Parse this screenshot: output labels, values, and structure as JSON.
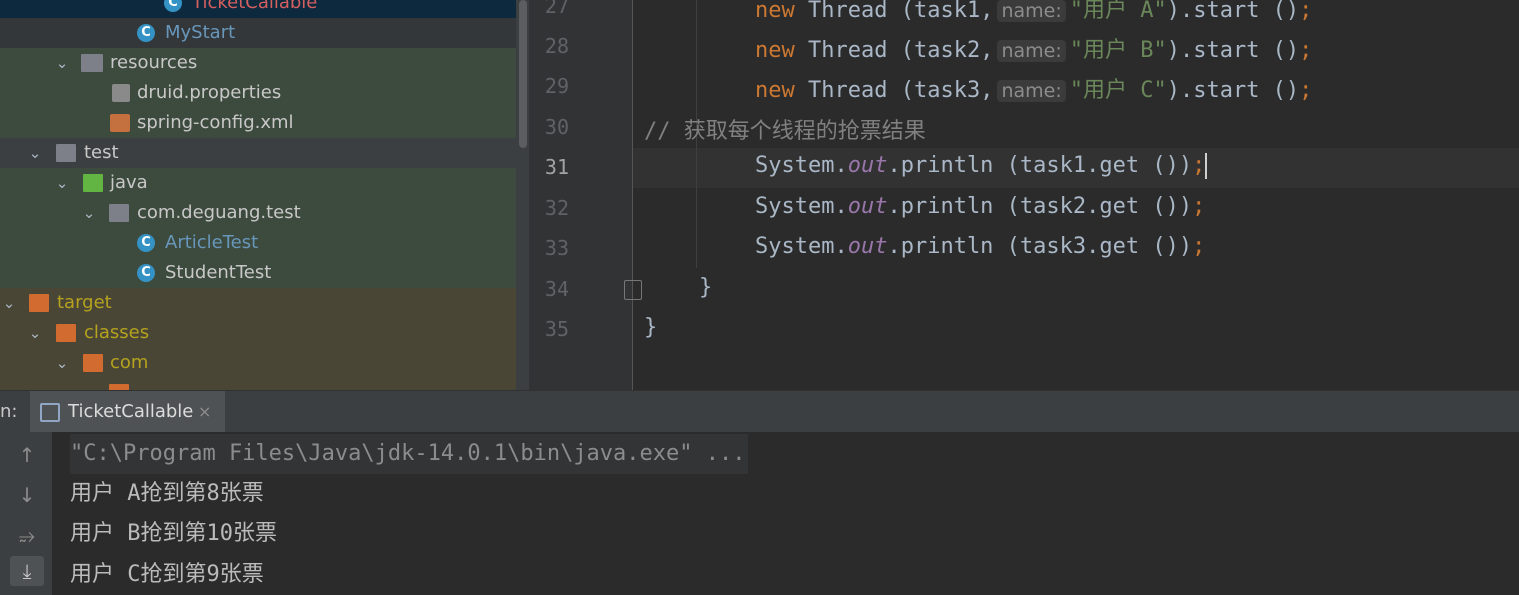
{
  "tree": {
    "items": [
      {
        "label": "TicketCallable",
        "icon": "class-icon",
        "level": 6
      },
      {
        "label": "MyStart",
        "icon": "class-icon",
        "level": 5
      },
      {
        "label": "resources",
        "icon": "resources-folder-icon",
        "level": 2
      },
      {
        "label": "druid.properties",
        "icon": "properties-file-icon",
        "level": 3
      },
      {
        "label": "spring-config.xml",
        "icon": "xml-file-icon",
        "level": 3
      },
      {
        "label": "test",
        "icon": "folder-icon",
        "level": 1
      },
      {
        "label": "java",
        "icon": "test-source-folder-icon",
        "level": 2
      },
      {
        "label": "com.deguang.test",
        "icon": "package-icon",
        "level": 3
      },
      {
        "label": "ArticleTest",
        "icon": "class-icon",
        "level": 4
      },
      {
        "label": "StudentTest",
        "icon": "class-icon",
        "level": 4
      },
      {
        "label": "target",
        "icon": "excluded-folder-icon",
        "level": 0
      },
      {
        "label": "classes",
        "icon": "excluded-folder-icon",
        "level": 1
      },
      {
        "label": "com",
        "icon": "excluded-folder-icon",
        "level": 2
      }
    ]
  },
  "editor": {
    "line_numbers": [
      "27",
      "28",
      "29",
      "30",
      "31",
      "32",
      "33",
      "34",
      "35"
    ],
    "current_line": "31",
    "code": {
      "kw_new": "new",
      "thread_open": " Thread (task",
      "t1": "1,",
      "t2": "2,",
      "t3": "3,",
      "hint": "name:",
      "s1": "\"用户 A\"",
      "s2": "\"用户 B\"",
      "s3": "\"用户 C\"",
      "start": ").start ()",
      "semi": ";",
      "comment": "// 获取每个线程的抢票结果",
      "sys": "System.",
      "out": "out",
      "p1": ".println (task1.get ())",
      "p2": ".println (task2.get ())",
      "p3": ".println (task3.get ())",
      "brace_inner": "}",
      "brace_outer": "}"
    }
  },
  "run": {
    "label": "n:",
    "tab_label": "TicketCallable",
    "tab_close": "×",
    "output": [
      "\"C:\\Program Files\\Java\\jdk-14.0.1\\bin\\java.exe\" ...",
      "用户 A抢到第8张票",
      "用户 B抢到第10张票",
      "用户 C抢到第9张票"
    ],
    "tools": {
      "up": "↑",
      "down": "↓",
      "wrap": "⥴",
      "scroll_end": "⤓"
    }
  },
  "colors": {
    "keyword": "#cc7832",
    "string": "#6a8759",
    "field": "#9876aa",
    "comment": "#808080",
    "class_blue": "#6897bb"
  }
}
